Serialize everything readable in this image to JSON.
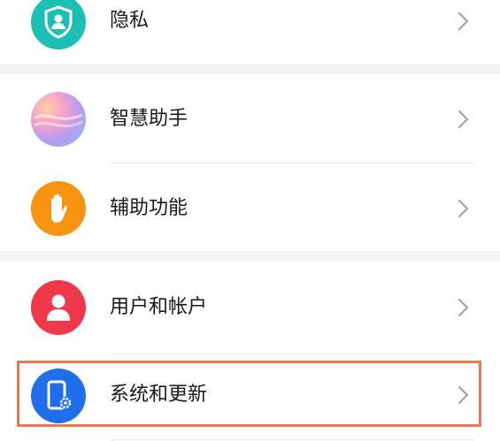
{
  "settings": {
    "items": [
      {
        "label": "隐私",
        "icon": "privacy-shield-icon",
        "color": "#1bbfb3"
      },
      {
        "label": "智慧助手",
        "icon": "smart-assistant-icon",
        "color": "#b08ee8"
      },
      {
        "label": "辅助功能",
        "icon": "accessibility-hand-icon",
        "color": "#f7930f"
      },
      {
        "label": "用户和帐户",
        "icon": "user-account-icon",
        "color": "#f0384b"
      },
      {
        "label": "系统和更新",
        "icon": "system-update-icon",
        "color": "#1f6fed"
      }
    ],
    "chevron": "chevron-right-icon",
    "highlight_color": "#ec7a4f",
    "highlighted_item": "系统和更新"
  }
}
